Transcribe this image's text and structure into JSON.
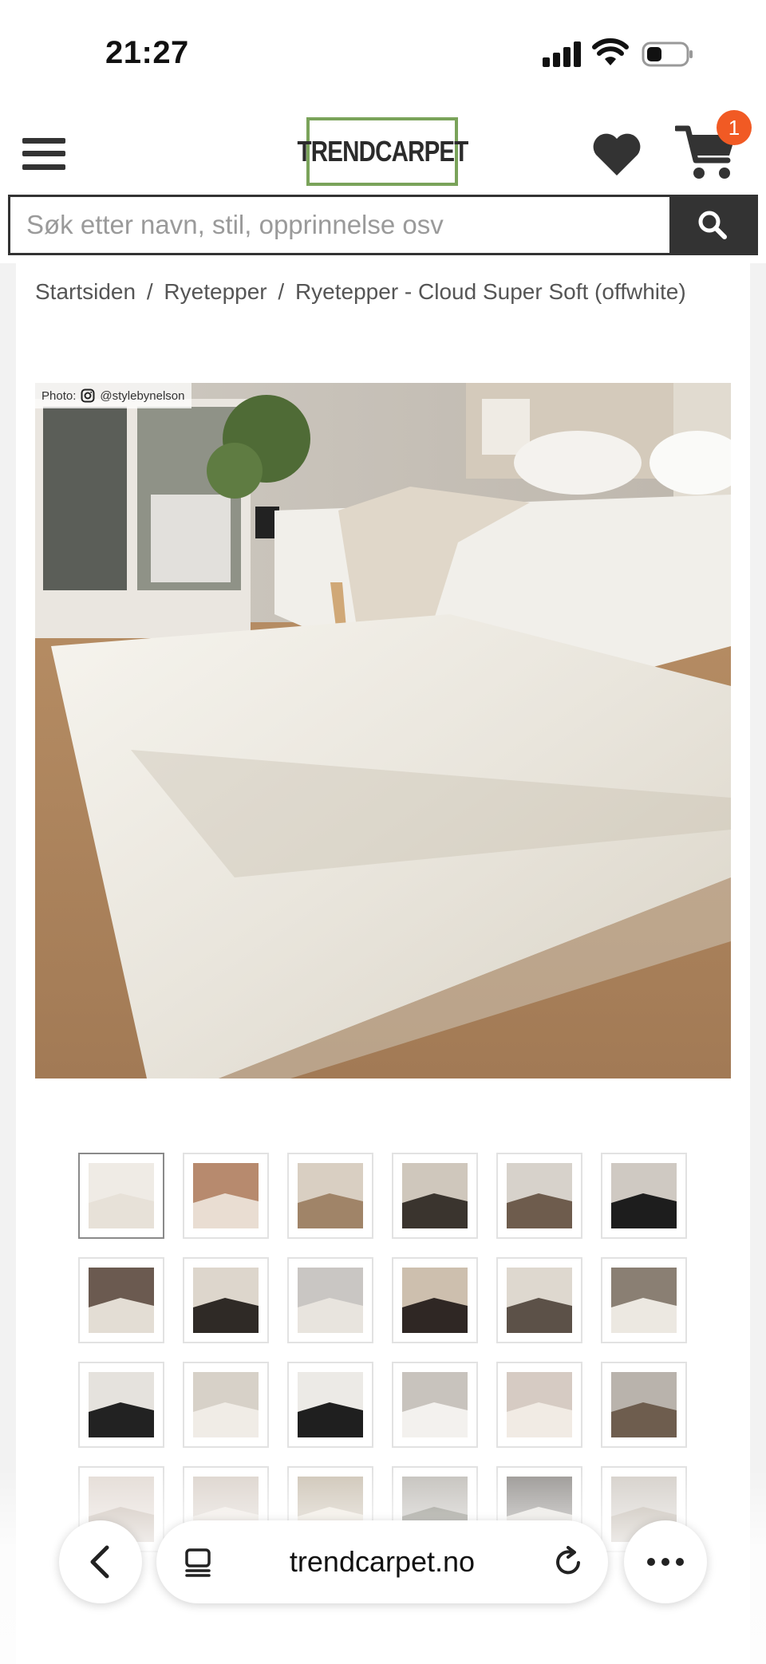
{
  "status_bar": {
    "time": "21:27"
  },
  "header": {
    "logo_text": "TRENDCARPET",
    "logo_border_color": "#7aa35a",
    "cart_count": "1",
    "cart_badge_color": "#f15a24",
    "icons": [
      "menu-icon",
      "heart-icon",
      "cart-icon"
    ]
  },
  "search": {
    "placeholder": "Søk etter navn, stil, opprinnelse osv",
    "value": ""
  },
  "breadcrumb": {
    "items": [
      "Startsiden",
      "Ryetepper",
      "Ryetepper - Cloud Super Soft (offwhite)"
    ],
    "separator": "/"
  },
  "product_image": {
    "photo_credit_label": "Photo:",
    "photo_credit_handle": "@stylebynelson"
  },
  "thumbnails": {
    "selected_index": 0,
    "count": 24,
    "colors": [
      [
        "#efebe5",
        "#e7e1d8"
      ],
      [
        "#b78a6e",
        "#e9ddd2"
      ],
      [
        "#d9cfc2",
        "#a08468"
      ],
      [
        "#cfc7bc",
        "#3a342e"
      ],
      [
        "#d7d2cb",
        "#6e5c4d"
      ],
      [
        "#cfc9c2",
        "#1d1d1d"
      ],
      [
        "#6b5a50",
        "#e3ddd4"
      ],
      [
        "#ddd6cc",
        "#2f2a26"
      ],
      [
        "#c9c6c3",
        "#e8e4de"
      ],
      [
        "#cdbfae",
        "#2f2724"
      ],
      [
        "#ded8cf",
        "#5c5148"
      ],
      [
        "#8a7f73",
        "#ece8e1"
      ],
      [
        "#e5e2dd",
        "#222222"
      ],
      [
        "#d7d1c8",
        "#f0ece6"
      ],
      [
        "#eceae6",
        "#1f1f1f"
      ],
      [
        "#c8c3bd",
        "#f3f1ee"
      ],
      [
        "#d6cbc3",
        "#f1ebe4"
      ],
      [
        "#b9b3ac",
        "#6e5d4e"
      ],
      [
        "#e4dcd6",
        "#c9bdb3"
      ],
      [
        "#ddd5ce",
        "#efe9e3"
      ],
      [
        "#cfc6b8",
        "#efe9df"
      ],
      [
        "#c4c1bc",
        "#8b8a80"
      ],
      [
        "#9a9794",
        "#e7e4df"
      ],
      [
        "#d5d0ca",
        "#bfb6ab"
      ]
    ]
  },
  "browser": {
    "url": "trendcarpet.no"
  }
}
